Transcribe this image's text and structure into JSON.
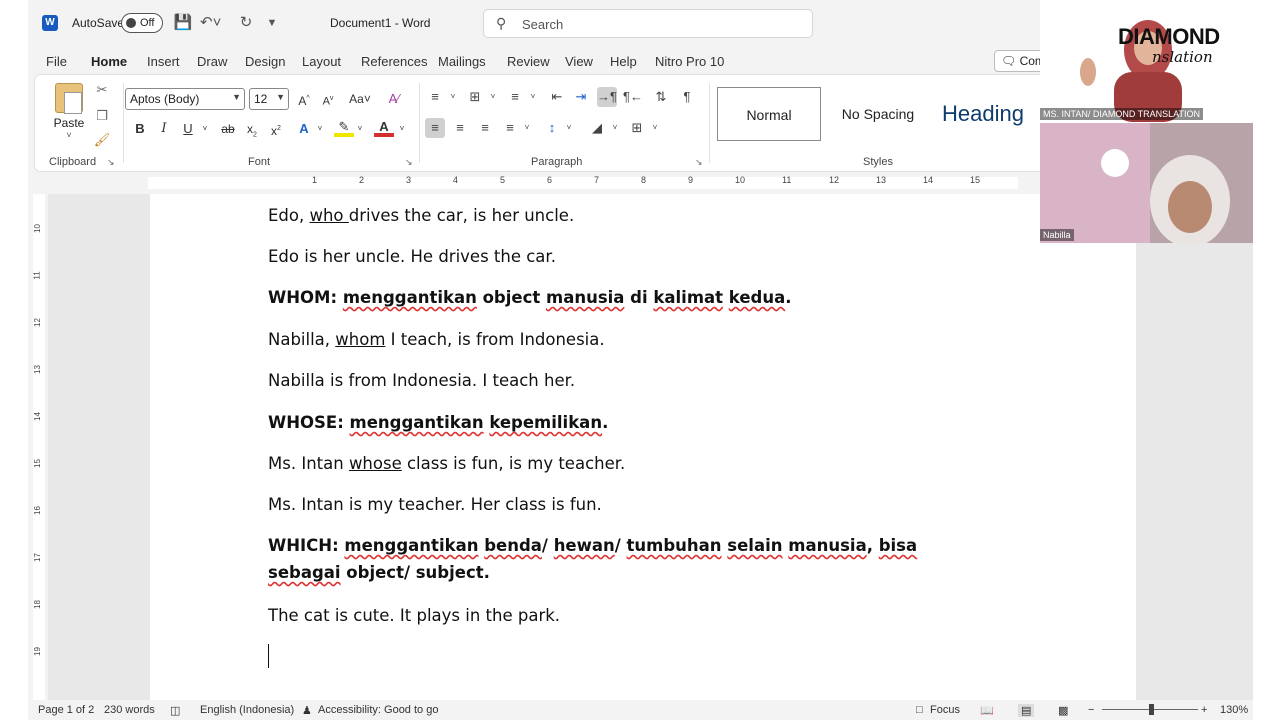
{
  "titlebar": {
    "autosave_label": "AutoSave",
    "autosave_state": "Off",
    "doc_title": "Document1  -  Word",
    "search_placeholder": "Search"
  },
  "menu": {
    "tabs": [
      "File",
      "Home",
      "Insert",
      "Draw",
      "Design",
      "Layout",
      "References",
      "Mailings",
      "Review",
      "View",
      "Help",
      "Nitro Pro 10"
    ],
    "active": "Home",
    "comments_label": "Com"
  },
  "ribbon": {
    "clipboard": {
      "paste_label": "Paste",
      "group_label": "Clipboard"
    },
    "font": {
      "family": "Aptos (Body)",
      "size": "12",
      "group_label": "Font"
    },
    "paragraph": {
      "group_label": "Paragraph"
    },
    "styles": {
      "items": [
        "Normal",
        "No Spacing",
        "Heading"
      ],
      "group_label": "Styles"
    }
  },
  "ruler": {
    "numbers": [
      "1",
      "2",
      "3",
      "4",
      "5",
      "6",
      "7",
      "8",
      "9",
      "10",
      "11",
      "12",
      "13",
      "14",
      "15"
    ]
  },
  "vruler": {
    "numbers": [
      "10",
      "11",
      "12",
      "13",
      "14",
      "15",
      "16",
      "17",
      "18",
      "19"
    ]
  },
  "document": {
    "p1": {
      "pre": "Edo, ",
      "ul": "who ",
      "post": "drives the car, is her uncle."
    },
    "p2": "Edo is her uncle. He drives the car.",
    "p3": {
      "a": "WHOM: ",
      "b": "menggantikan",
      "c": " object ",
      "d": "manusia",
      "e": " di ",
      "f": "kalimat",
      "g": " ",
      "h": "kedua",
      "i": "."
    },
    "p4": {
      "pre": "Nabilla, ",
      "ul": "whom",
      "post": " I teach, is from Indonesia."
    },
    "p5": "Nabilla is from Indonesia. I teach her.",
    "p6": {
      "a": "WHOSE: ",
      "b": "menggantikan",
      "c": " ",
      "d": "kepemilikan",
      "e": "."
    },
    "p7": {
      "pre": "Ms. Intan ",
      "ul": "whose",
      "post": " class is fun, is my teacher."
    },
    "p8": "Ms. Intan is my teacher. Her class is fun.",
    "p9": {
      "a": "WHICH: ",
      "b": "menggantikan",
      "c": " ",
      "d": "benda",
      "e": "/ ",
      "f": "hewan",
      "g": "/ ",
      "h": "tumbuhan",
      "i": " ",
      "j": "selain",
      "k": " ",
      "l": "manusia",
      "m": ", ",
      "n": "bisa",
      "o": " ",
      "p": "sebagai",
      "q": " object/ subject."
    },
    "p10": "The cat is cute. It plays in the park."
  },
  "statusbar": {
    "page": "Page 1 of 2",
    "words": "230 words",
    "language": "English (Indonesia)",
    "accessibility": "Accessibility: Good to go",
    "focus": "Focus",
    "zoom": "130%"
  },
  "video": {
    "host_label": "MS. INTAN/ DIAMOND TRANSLATION",
    "brand_main": "DIAMOND",
    "brand_sub": "nslation",
    "guest_label": "Nabilla"
  },
  "colors": {
    "accent": "#185abd",
    "squiggle": "#d33333"
  }
}
